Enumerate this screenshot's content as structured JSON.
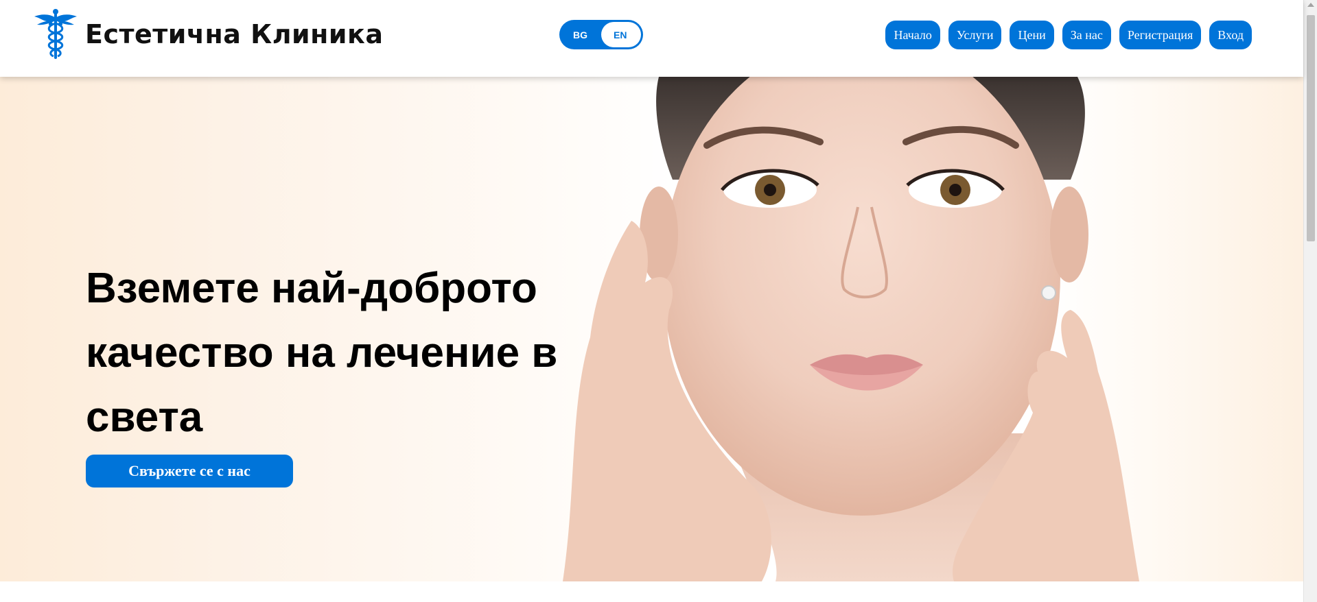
{
  "header": {
    "brand_name": "Естетична Клиника",
    "logo_icon": "caduceus-icon",
    "language_toggle": {
      "options": [
        "BG",
        "EN"
      ],
      "selected": "EN"
    },
    "nav": [
      {
        "label": "Начало"
      },
      {
        "label": "Услуги"
      },
      {
        "label": "Цени"
      },
      {
        "label": "За нас"
      },
      {
        "label": "Регистрация"
      },
      {
        "label": "Вход"
      }
    ]
  },
  "hero": {
    "title": "Вземете най-доброто качество на лечение в света",
    "cta_label": "Свържете се с нас",
    "image": "woman-face-portrait"
  },
  "colors": {
    "accent": "#0074d9",
    "hero_background": "#fdecd9",
    "text": "#000000"
  }
}
